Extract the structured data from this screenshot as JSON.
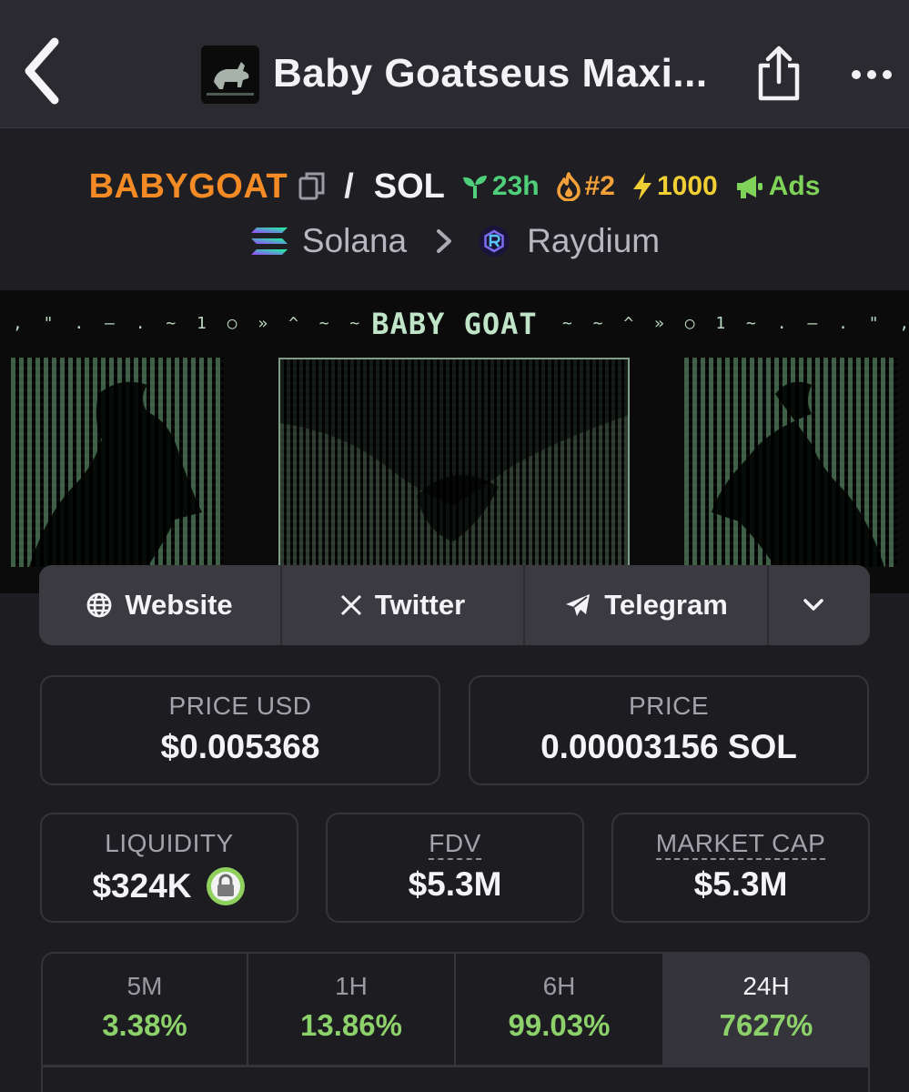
{
  "nav": {
    "title": "Baby Goatseus Maxi...",
    "back_icon": "chevron-left-icon",
    "share_icon": "share-icon",
    "more_icon": "more-horizontal-icon"
  },
  "pair": {
    "base": "BABYGOAT",
    "separator": "/",
    "quote": "SOL",
    "badges": {
      "age": "23h",
      "rank": "#2",
      "boosts": "1000",
      "ads": "Ads"
    },
    "chain": "Solana",
    "dex": "Raydium"
  },
  "banner": {
    "title": "BABY GOAT",
    "dots_left": ", \" . — . ~ 1 ○ » ^ ~ ~",
    "dots_right": "~ ~ ^ » ○ 1 ~ . — . \" ,"
  },
  "links": [
    {
      "label": "Website",
      "icon": "globe-icon"
    },
    {
      "label": "Twitter",
      "icon": "x-logo-icon"
    },
    {
      "label": "Telegram",
      "icon": "telegram-icon"
    }
  ],
  "stats": {
    "price_usd": {
      "label": "PRICE USD",
      "value": "$0.005368"
    },
    "price_native": {
      "label": "PRICE",
      "value": "0.00003156 SOL"
    },
    "liquidity": {
      "label": "LIQUIDITY",
      "value": "$324K"
    },
    "fdv": {
      "label": "FDV",
      "value": "$5.3M"
    },
    "market_cap": {
      "label": "MARKET CAP",
      "value": "$5.3M"
    }
  },
  "timeframes": [
    {
      "label": "5M",
      "change": "3.38%"
    },
    {
      "label": "1H",
      "change": "13.86%"
    },
    {
      "label": "6H",
      "change": "99.03%"
    },
    {
      "label": "24H",
      "change": "7627%",
      "active": true
    }
  ],
  "colors": {
    "background": "#1c1c21",
    "base_symbol": "#f58b25",
    "positive": "#8dd16b",
    "age_badge": "#4fcf7a",
    "rank_badge": "#f5a13a",
    "boost_badge": "#f0cf35"
  }
}
